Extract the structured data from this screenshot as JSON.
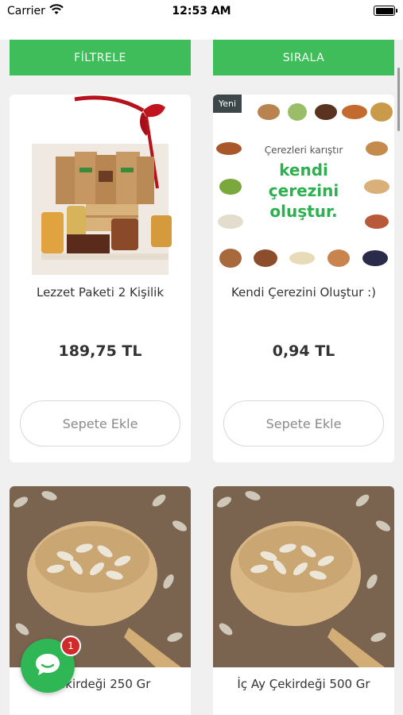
{
  "status": {
    "carrier": "Carrier",
    "time": "12:53 AM"
  },
  "toolbar": {
    "filter_label": "FİLTRELE",
    "sort_label": "SIRALA"
  },
  "products": [
    {
      "name": "Lezzet Paketi 2 Kişilik",
      "price": "189,75 TL",
      "button": "Sepete Ekle",
      "image_icon": "gift-package-photo"
    },
    {
      "name": "Kendi Çerezini Oluştur :)",
      "price": "0,94 TL",
      "button": "Sepete Ekle",
      "badge": "Yeni",
      "promo_line1": "Çerezleri karıştır",
      "promo_line2": "kendi",
      "promo_line3": "çerezini",
      "promo_line4": "oluştur.",
      "image_icon": "mixed-nuts-photo"
    },
    {
      "name": "Çekirdeği 250 Gr",
      "image_icon": "sunflower-seeds-photo"
    },
    {
      "name": "İç Ay Çekirdeği 500 Gr",
      "image_icon": "sunflower-seeds-photo"
    }
  ],
  "chat": {
    "icon": "chat-bubble-icon",
    "unread_count": "1"
  },
  "colors": {
    "accent": "#3fbd5a",
    "chat": "#2fb655",
    "badge": "#d12a2a"
  }
}
